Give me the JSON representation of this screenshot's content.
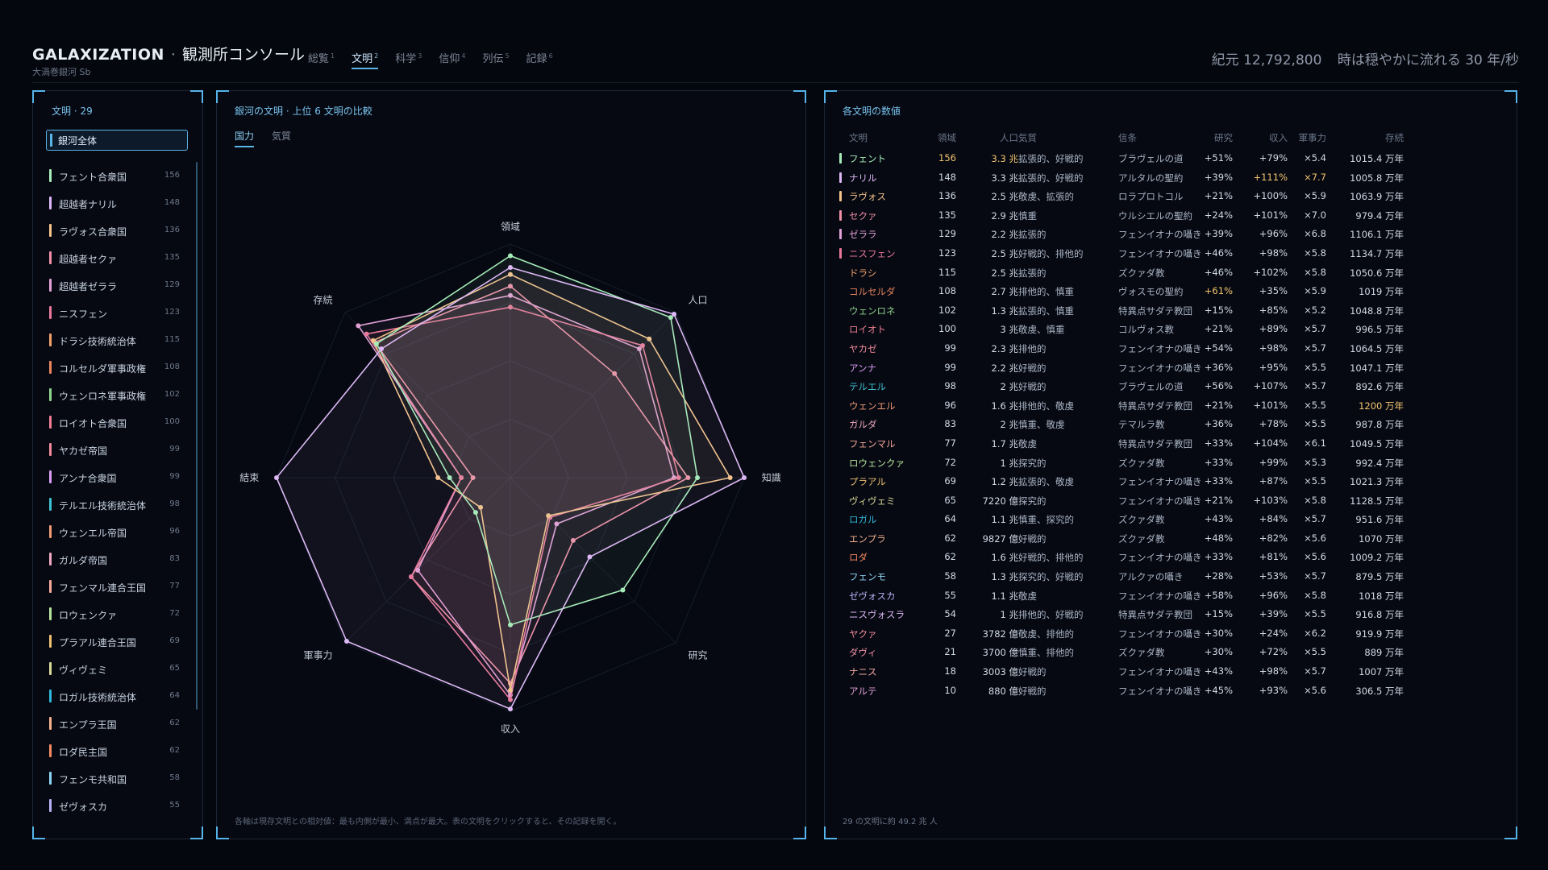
{
  "header": {
    "brand": "GALAXIZATION",
    "console": "観測所コンソール",
    "subtitle": "大渦巻銀河 Sb",
    "tabs": [
      {
        "label": "総覧",
        "count": "1",
        "active": false
      },
      {
        "label": "文明",
        "count": "2",
        "active": true
      },
      {
        "label": "科学",
        "count": "3",
        "active": false
      },
      {
        "label": "信仰",
        "count": "4",
        "active": false
      },
      {
        "label": "列伝",
        "count": "5",
        "active": false
      },
      {
        "label": "記録",
        "count": "6",
        "active": false
      }
    ],
    "era": "紀元 12,792,800",
    "speed": "時は穏やかに流れる 30 年/秒"
  },
  "left": {
    "title": "文明 · 29",
    "galaxy_all": "銀河全体",
    "items": [
      {
        "name": "フェント合衆国",
        "count": "156",
        "color": "#a6ecb8"
      },
      {
        "name": "超越者ナリル",
        "count": "148",
        "color": "#dcb8f4"
      },
      {
        "name": "ラヴォス合衆国",
        "count": "136",
        "color": "#f3c38a"
      },
      {
        "name": "超越者セクァ",
        "count": "135",
        "color": "#ef8fa6"
      },
      {
        "name": "超越者ゼララ",
        "count": "129",
        "color": "#e2a0d6"
      },
      {
        "name": "ニスフェン",
        "count": "123",
        "color": "#e8789a"
      },
      {
        "name": "ドラシ技術統治体",
        "count": "115",
        "color": "#f2a06a"
      },
      {
        "name": "コルセルダ軍事政権",
        "count": "108",
        "color": "#e8845e"
      },
      {
        "name": "ウェンロネ軍事政権",
        "count": "102",
        "color": "#8fd38c"
      },
      {
        "name": "ロイオト合衆国",
        "count": "100",
        "color": "#ee7e92"
      },
      {
        "name": "ヤカゼ帝国",
        "count": "99",
        "color": "#f08a9a"
      },
      {
        "name": "アンナ合衆国",
        "count": "99",
        "color": "#d89cf0"
      },
      {
        "name": "テルエル技術統治体",
        "count": "98",
        "color": "#3ec0d0"
      },
      {
        "name": "ウェンエル帝国",
        "count": "96",
        "color": "#f29a74"
      },
      {
        "name": "ガルダ帝国",
        "count": "83",
        "color": "#f0a8c0"
      },
      {
        "name": "フェンマル連合王国",
        "count": "77",
        "color": "#f6a89a"
      },
      {
        "name": "ロウェンクァ",
        "count": "72",
        "color": "#b6e39a"
      },
      {
        "name": "プラアル連合王国",
        "count": "69",
        "color": "#ecc070"
      },
      {
        "name": "ヴィヴェミ",
        "count": "65",
        "color": "#d8d898"
      },
      {
        "name": "ロガル技術統治体",
        "count": "64",
        "color": "#2fb6d8"
      },
      {
        "name": "エンプラ王国",
        "count": "62",
        "color": "#f4b08c"
      },
      {
        "name": "ロダ民主国",
        "count": "62",
        "color": "#f28a62"
      },
      {
        "name": "フェンモ共和国",
        "count": "58",
        "color": "#8cd4f2"
      },
      {
        "name": "ゼヴォスカ",
        "count": "55",
        "color": "#b8b0f4"
      }
    ]
  },
  "mid": {
    "title": "銀河の文明 · 上位 6 文明の比較",
    "tabs": [
      {
        "label": "国力",
        "active": true
      },
      {
        "label": "気質",
        "active": false
      }
    ],
    "footnote": "各軸は現存文明との相対値：最も内側が最小、満点が最大。表の文明をクリックすると、その記録を開く。"
  },
  "chart_data": {
    "type": "radar",
    "axes": [
      "領域",
      "人口",
      "知識",
      "研究",
      "収入",
      "軍事力",
      "結束",
      "存続"
    ],
    "range": [
      0,
      1
    ],
    "grid": true,
    "series": [
      {
        "color": "#ef8fa6",
        "values": [
          0.82,
          0.63,
          0.76,
          0.38,
          0.88,
          0.6,
          0.16,
          0.82
        ]
      },
      {
        "color": "#e2a0d6",
        "values": [
          0.78,
          0.78,
          0.7,
          0.28,
          0.93,
          0.56,
          0.21,
          0.92
        ]
      },
      {
        "color": "#e8789a",
        "values": [
          0.73,
          0.8,
          0.72,
          0.24,
          0.95,
          0.6,
          0.21,
          0.87
        ]
      },
      {
        "color": "#f3c38a",
        "values": [
          0.87,
          0.84,
          0.94,
          0.23,
          0.91,
          0.18,
          0.31,
          0.83
        ]
      },
      {
        "color": "#a6ecb8",
        "values": [
          0.95,
          0.97,
          0.8,
          0.68,
          0.63,
          0.21,
          0.26,
          0.81
        ]
      },
      {
        "color": "#dcb8f4",
        "values": [
          0.9,
          0.99,
          1.0,
          0.48,
          0.99,
          0.99,
          1.0,
          0.78
        ]
      }
    ]
  },
  "right": {
    "title": "各文明の数値",
    "columns": {
      "name": "文明",
      "terr": "領域",
      "pop": "人口",
      "temp": "気質",
      "belief": "信条",
      "res": "研究",
      "inc": "収入",
      "mil": "軍事力",
      "surv": "存続"
    },
    "rows": [
      {
        "name": "フェント",
        "terr": "156",
        "pop": "3.3 兆",
        "temp": "拡張的、好戦的",
        "belief": "ブラヴェルの道",
        "res": "+51%",
        "inc": "+79%",
        "mil": "×5.4",
        "surv": "1015.4 万年",
        "color": "#a6ecb8",
        "bar": true,
        "hl": [
          "terr",
          "pop"
        ]
      },
      {
        "name": "ナリル",
        "terr": "148",
        "pop": "3.3 兆",
        "temp": "拡張的、好戦的",
        "belief": "アルタルの聖約",
        "res": "+39%",
        "inc": "+111%",
        "mil": "×7.7",
        "surv": "1005.8 万年",
        "color": "#dcb8f4",
        "bar": true,
        "hl": [
          "inc",
          "mil"
        ]
      },
      {
        "name": "ラヴォス",
        "terr": "136",
        "pop": "2.5 兆",
        "temp": "敬虔、拡張的",
        "belief": "ロラプロトコル",
        "res": "+21%",
        "inc": "+100%",
        "mil": "×5.9",
        "surv": "1063.9 万年",
        "color": "#f3c38a",
        "bar": true,
        "hl": []
      },
      {
        "name": "セクァ",
        "terr": "135",
        "pop": "2.9 兆",
        "temp": "慎重",
        "belief": "ウルシエルの聖約",
        "res": "+24%",
        "inc": "+101%",
        "mil": "×7.0",
        "surv": "979.4 万年",
        "color": "#ef8fa6",
        "bar": true,
        "hl": []
      },
      {
        "name": "ゼララ",
        "terr": "129",
        "pop": "2.2 兆",
        "temp": "拡張的",
        "belief": "フェンイオナの囁き",
        "res": "+39%",
        "inc": "+96%",
        "mil": "×6.8",
        "surv": "1106.1 万年",
        "color": "#e2a0d6",
        "bar": true,
        "hl": []
      },
      {
        "name": "ニスフェン",
        "terr": "123",
        "pop": "2.5 兆",
        "temp": "好戦的、排他的",
        "belief": "フェンイオナの囁き",
        "res": "+46%",
        "inc": "+98%",
        "mil": "×5.8",
        "surv": "1134.7 万年",
        "color": "#e8789a",
        "bar": true,
        "hl": []
      },
      {
        "name": "ドラシ",
        "terr": "115",
        "pop": "2.5 兆",
        "temp": "拡張的",
        "belief": "ズクァダ教",
        "res": "+46%",
        "inc": "+102%",
        "mil": "×5.8",
        "surv": "1050.6 万年",
        "color": "#f2a06a",
        "bar": false,
        "hl": []
      },
      {
        "name": "コルセルダ",
        "terr": "108",
        "pop": "2.7 兆",
        "temp": "排他的、慎重",
        "belief": "ヴォスモの聖約",
        "res": "+61%",
        "inc": "+35%",
        "mil": "×5.9",
        "surv": "1019 万年",
        "color": "#e8845e",
        "bar": false,
        "hl": [
          "res"
        ]
      },
      {
        "name": "ウェンロネ",
        "terr": "102",
        "pop": "1.3 兆",
        "temp": "拡張的、慎重",
        "belief": "特異点サダテ教団",
        "res": "+15%",
        "inc": "+85%",
        "mil": "×5.2",
        "surv": "1048.8 万年",
        "color": "#8fd38c",
        "bar": false,
        "hl": []
      },
      {
        "name": "ロイオト",
        "terr": "100",
        "pop": "3 兆",
        "temp": "敬虔、慎重",
        "belief": "コルヴォス教",
        "res": "+21%",
        "inc": "+89%",
        "mil": "×5.7",
        "surv": "996.5 万年",
        "color": "#ee7e92",
        "bar": false,
        "hl": []
      },
      {
        "name": "ヤカゼ",
        "terr": "99",
        "pop": "2.3 兆",
        "temp": "排他的",
        "belief": "フェンイオナの囁き",
        "res": "+54%",
        "inc": "+98%",
        "mil": "×5.7",
        "surv": "1064.5 万年",
        "color": "#f08a9a",
        "bar": false,
        "hl": []
      },
      {
        "name": "アンナ",
        "terr": "99",
        "pop": "2.2 兆",
        "temp": "好戦的",
        "belief": "フェンイオナの囁き",
        "res": "+36%",
        "inc": "+95%",
        "mil": "×5.5",
        "surv": "1047.1 万年",
        "color": "#d89cf0",
        "bar": false,
        "hl": []
      },
      {
        "name": "テルエル",
        "terr": "98",
        "pop": "2 兆",
        "temp": "好戦的",
        "belief": "ブラヴェルの道",
        "res": "+56%",
        "inc": "+107%",
        "mil": "×5.7",
        "surv": "892.6 万年",
        "color": "#3ec0d0",
        "bar": false,
        "hl": []
      },
      {
        "name": "ウェンエル",
        "terr": "96",
        "pop": "1.6 兆",
        "temp": "排他的、敬虔",
        "belief": "特異点サダテ教団",
        "res": "+21%",
        "inc": "+101%",
        "mil": "×5.5",
        "surv": "1200 万年",
        "color": "#f29a74",
        "bar": false,
        "hl": [
          "surv"
        ]
      },
      {
        "name": "ガルダ",
        "terr": "83",
        "pop": "2 兆",
        "temp": "慎重、敬虔",
        "belief": "テマルラ教",
        "res": "+36%",
        "inc": "+78%",
        "mil": "×5.5",
        "surv": "987.8 万年",
        "color": "#f0a8c0",
        "bar": false,
        "hl": []
      },
      {
        "name": "フェンマル",
        "terr": "77",
        "pop": "1.7 兆",
        "temp": "敬虔",
        "belief": "特異点サダテ教団",
        "res": "+33%",
        "inc": "+104%",
        "mil": "×6.1",
        "surv": "1049.5 万年",
        "color": "#f6a89a",
        "bar": false,
        "hl": []
      },
      {
        "name": "ロウェンクァ",
        "terr": "72",
        "pop": "1 兆",
        "temp": "探究的",
        "belief": "ズクァダ教",
        "res": "+33%",
        "inc": "+99%",
        "mil": "×5.3",
        "surv": "992.4 万年",
        "color": "#b6e39a",
        "bar": false,
        "hl": []
      },
      {
        "name": "プラアル",
        "terr": "69",
        "pop": "1.2 兆",
        "temp": "拡張的、敬虔",
        "belief": "フェンイオナの囁き",
        "res": "+33%",
        "inc": "+87%",
        "mil": "×5.5",
        "surv": "1021.3 万年",
        "color": "#ecc070",
        "bar": false,
        "hl": []
      },
      {
        "name": "ヴィヴェミ",
        "terr": "65",
        "pop": "7220 億",
        "temp": "探究的",
        "belief": "フェンイオナの囁き",
        "res": "+21%",
        "inc": "+103%",
        "mil": "×5.8",
        "surv": "1128.5 万年",
        "color": "#d8d898",
        "bar": false,
        "hl": []
      },
      {
        "name": "ロガル",
        "terr": "64",
        "pop": "1.1 兆",
        "temp": "慎重、探究的",
        "belief": "ズクァダ教",
        "res": "+43%",
        "inc": "+84%",
        "mil": "×5.7",
        "surv": "951.6 万年",
        "color": "#2fb6d8",
        "bar": false,
        "hl": []
      },
      {
        "name": "エンプラ",
        "terr": "62",
        "pop": "9827 億",
        "temp": "好戦的",
        "belief": "ズクァダ教",
        "res": "+48%",
        "inc": "+82%",
        "mil": "×5.6",
        "surv": "1070 万年",
        "color": "#f4b08c",
        "bar": false,
        "hl": []
      },
      {
        "name": "ロダ",
        "terr": "62",
        "pop": "1.6 兆",
        "temp": "好戦的、排他的",
        "belief": "フェンイオナの囁き",
        "res": "+33%",
        "inc": "+81%",
        "mil": "×5.6",
        "surv": "1009.2 万年",
        "color": "#f28a62",
        "bar": false,
        "hl": []
      },
      {
        "name": "フェンモ",
        "terr": "58",
        "pop": "1.3 兆",
        "temp": "探究的、好戦的",
        "belief": "アルクァの囁き",
        "res": "+28%",
        "inc": "+53%",
        "mil": "×5.7",
        "surv": "879.5 万年",
        "color": "#8cd4f2",
        "bar": false,
        "hl": []
      },
      {
        "name": "ゼヴォスカ",
        "terr": "55",
        "pop": "1.1 兆",
        "temp": "敬虔",
        "belief": "フェンイオナの囁き",
        "res": "+58%",
        "inc": "+96%",
        "mil": "×5.8",
        "surv": "1018 万年",
        "color": "#b8b0f4",
        "bar": false,
        "hl": []
      },
      {
        "name": "ニスヴォスラ",
        "terr": "54",
        "pop": "1 兆",
        "temp": "排他的、好戦的",
        "belief": "特異点サダテ教団",
        "res": "+15%",
        "inc": "+39%",
        "mil": "×5.5",
        "surv": "916.8 万年",
        "color": "#dcb8f4",
        "bar": false,
        "hl": []
      },
      {
        "name": "ヤクァ",
        "terr": "27",
        "pop": "3782 億",
        "temp": "敬虔、排他的",
        "belief": "フェンイオナの囁き",
        "res": "+30%",
        "inc": "+24%",
        "mil": "×6.2",
        "surv": "919.9 万年",
        "color": "#f08a9a",
        "bar": false,
        "hl": []
      },
      {
        "name": "ダヴィ",
        "terr": "21",
        "pop": "3700 億",
        "temp": "慎重、排他的",
        "belief": "ズクァダ教",
        "res": "+30%",
        "inc": "+72%",
        "mil": "×5.5",
        "surv": "889 万年",
        "color": "#ef8fa6",
        "bar": false,
        "hl": []
      },
      {
        "name": "ナニス",
        "terr": "18",
        "pop": "3003 億",
        "temp": "好戦的",
        "belief": "フェンイオナの囁き",
        "res": "+43%",
        "inc": "+98%",
        "mil": "×5.7",
        "surv": "1007 万年",
        "color": "#f4a8a0",
        "bar": false,
        "hl": []
      },
      {
        "name": "アルテ",
        "terr": "10",
        "pop": "880 億",
        "temp": "好戦的",
        "belief": "フェンイオナの囁き",
        "res": "+45%",
        "inc": "+93%",
        "mil": "×5.6",
        "surv": "306.5 万年",
        "color": "#e2a0d6",
        "bar": false,
        "hl": []
      }
    ],
    "footer": "29 の文明に約 49.2 兆 人"
  }
}
